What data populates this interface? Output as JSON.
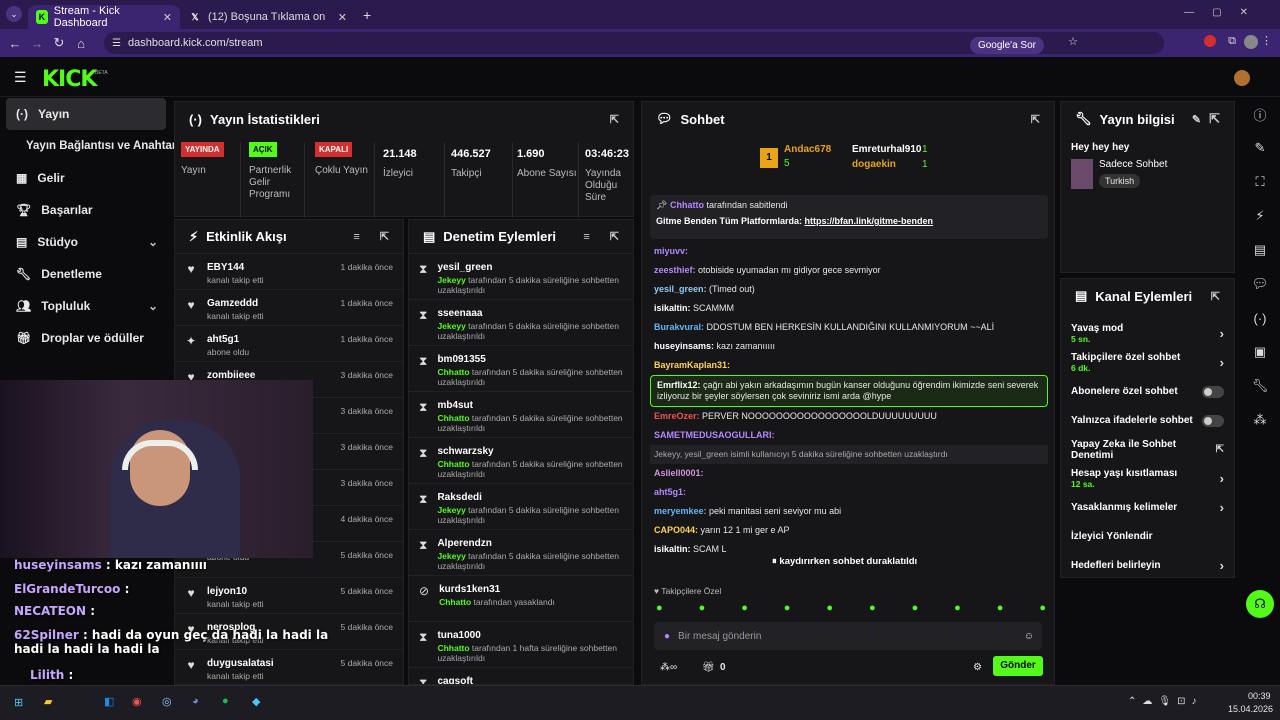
{
  "browser": {
    "tabs": [
      {
        "title": "Stream - Kick Dashboard",
        "active": true
      },
      {
        "title": "(12) Boşuna Tıklama on X: \"Bir ...",
        "active": false
      }
    ],
    "url": "dashboard.kick.com/stream",
    "google_btn": "Google'a Sor"
  },
  "brand": {
    "logo": "KICK",
    "beta": "BETA",
    "accent": "#53fc18"
  },
  "sidebar": {
    "items": [
      {
        "label": "Yayın",
        "icon": "broadcast-icon"
      },
      {
        "label": "Yayın Bağlantısı ve Anahtarı",
        "icon": ""
      },
      {
        "label": "Gelir",
        "icon": "revenue-icon"
      },
      {
        "label": "Başarılar",
        "icon": "trophy-icon"
      },
      {
        "label": "Stüdyo",
        "icon": "studio-icon"
      },
      {
        "label": "Denetleme",
        "icon": "wrench-icon"
      },
      {
        "label": "Topluluk",
        "icon": "community-icon"
      },
      {
        "label": "Droplar ve ödüller",
        "icon": "gift-icon"
      }
    ]
  },
  "stats": {
    "title": "Yayın İstatistikleri",
    "items": [
      {
        "badge": "YAYINDA",
        "label": "Yayın"
      },
      {
        "badge": "AÇIK",
        "label": "Partnerlik Gelir Programı"
      },
      {
        "badge": "KAPALI",
        "label": "Çoklu Yayın"
      },
      {
        "value": "21.148",
        "label": "İzleyici"
      },
      {
        "value": "446.527",
        "label": "Takipçi"
      },
      {
        "value": "1.690",
        "label": "Abone Sayısı"
      },
      {
        "value": "03:46:23",
        "label": "Yayında Olduğu Süre"
      }
    ]
  },
  "activity": {
    "title": "Etkinlik Akışı",
    "rows": [
      {
        "name": "EBY144",
        "sub": "kanalı takip etti",
        "time": "1 dakika önce",
        "icon": "heart"
      },
      {
        "name": "Gamzeddd",
        "sub": "kanalı takip etti",
        "time": "1 dakika önce",
        "icon": "heart"
      },
      {
        "name": "aht5g1",
        "sub": "abone oldu",
        "time": "1 dakika önce",
        "icon": "star"
      },
      {
        "name": "zombiieee",
        "sub": "",
        "time": "3 dakika önce",
        "icon": "heart"
      },
      {
        "name": "",
        "sub": "",
        "time": "3 dakika önce",
        "icon": ""
      },
      {
        "name": "",
        "sub": "",
        "time": "3 dakika önce",
        "icon": ""
      },
      {
        "name": "",
        "sub": "",
        "time": "3 dakika önce",
        "icon": ""
      },
      {
        "name": "",
        "sub": "",
        "time": "4 dakika önce",
        "icon": ""
      },
      {
        "name": "",
        "sub": "abone oldu",
        "time": "5 dakika önce",
        "icon": ""
      },
      {
        "name": "lejyon10",
        "sub": "kanalı takip etti",
        "time": "5 dakika önce",
        "icon": "heart"
      },
      {
        "name": "nerosplog",
        "sub": "kanalı takip etti",
        "time": "5 dakika önce",
        "icon": "heart"
      },
      {
        "name": "duygusalatasi",
        "sub": "kanalı takip etti",
        "time": "5 dakika önce",
        "icon": "heart"
      }
    ]
  },
  "moderation": {
    "title": "Denetim Eylemleri",
    "rows": [
      {
        "name": "yesil_green",
        "by": "Jekeyy",
        "sub": " tarafından 5 dakika süreliğine sohbetten uzaklaştırıldı",
        "time": "1 dakika önce",
        "icon": "⧗"
      },
      {
        "name": "sseenaaa",
        "by": "Jekeyy",
        "sub": " tarafından 5 dakika süreliğine sohbetten uzaklaştırıldı",
        "time": "1 dakika önce",
        "icon": "⧗"
      },
      {
        "name": "bm091355",
        "by": "Chhatto",
        "sub": " tarafından 5 dakika süreliğine sohbetten uzaklaştırıldı",
        "time": "1 dakika önce",
        "icon": "⧗"
      },
      {
        "name": "mb4sut",
        "by": "Chhatto",
        "sub": " tarafından 5 dakika süreliğine sohbetten uzaklaştırıldı",
        "time": "1 dakika önce",
        "icon": "⧗"
      },
      {
        "name": "schwarzsky",
        "by": "Chhatto",
        "sub": " tarafından 5 dakika süreliğine sohbetten uzaklaştırıldı",
        "time": "4 dakika önce",
        "icon": "⧗"
      },
      {
        "name": "Raksdedi",
        "by": "Jekeyy",
        "sub": " tarafından 5 dakika süreliğine sohbetten uzaklaştırıldı",
        "time": "4 dakika önce",
        "icon": "⧗"
      },
      {
        "name": "Alperendzn",
        "by": "Jekeyy",
        "sub": " tarafından 5 dakika süreliğine sohbetten uzaklaştırıldı",
        "time": "7 dakika önce",
        "icon": "⧗"
      },
      {
        "name": "kurds1ken31",
        "by": "Chhatto",
        "sub": " tarafından yasaklandı",
        "time": "13 dakika önce",
        "icon": "⊘"
      },
      {
        "name": "tuna1000",
        "by": "Chhatto",
        "sub": " tarafından 1 hafta süreliğine sohbetten uzaklaştırıldı",
        "time": "51 dakika önce",
        "icon": "⧗"
      },
      {
        "name": "cagsoft",
        "by": "",
        "sub": "",
        "time": "53 dakika önce",
        "icon": "⧗"
      }
    ]
  },
  "chat": {
    "title": "Sohbet",
    "leaders": [
      {
        "rank": "1",
        "name": "Andac678",
        "count": "5"
      },
      {
        "rank": "",
        "name": "Emreturhal910",
        "count": "1"
      },
      {
        "rank": "",
        "name": "dogaekin",
        "count": "1"
      }
    ],
    "pinned": {
      "by": "Chhatto",
      "by_suffix": " tarafından sabitlendi",
      "text": "Gitme Benden Tüm Platformlarda: ",
      "link": "https://bfan.link/gitme-benden"
    },
    "messages": [
      {
        "user": "miyuvv:",
        "text": "",
        "color": "#b388ff"
      },
      {
        "user": "zeesthief:",
        "text": " otobiside uyumadan mı gidiyor gece sevmiyor",
        "color": "#b388ff"
      },
      {
        "user": "yesil_green:",
        "text": " (Timed out)",
        "color": "#90caf9"
      },
      {
        "user": "isikaltin:",
        "text": " SCAMMM",
        "color": "#ffffff"
      },
      {
        "user": "Burakvural:",
        "text": " DDOSTUM BEN HERKESİN KULLANDIĞINI KULLANMIYORUM ~~ALİ",
        "color": "#64b5f6"
      },
      {
        "user": "huseyinsams:",
        "text": " kazı zamanııııı",
        "color": "#ffffff"
      },
      {
        "user": "BayramKaplan31:",
        "text": "",
        "color": "#ffd54f"
      },
      {
        "user": "Emrflix12:",
        "text": " çağrı abi yakın arkadaşımın bugün kanser olduğunu öğrendim ikimizde seni severek izliyoruz bir şeyler söylersen çok seviniriz ismi arda @hype",
        "color": "#ffffff"
      },
      {
        "user": "EmreOzer:",
        "text": " PERVER NOOOOOOOOOOOOOOOOOLDUUUUUUUUU",
        "color": "#ef5350"
      },
      {
        "user": "SAMETMEDUSAOGULLARI:",
        "text": "",
        "color": "#b388ff"
      },
      {
        "user": "",
        "text": "Jekeyy, yesil_green isimli kullanıcıyı 5 dakika süreliğine sohbetten uzaklaştırdı",
        "color": "#aaaaaa"
      },
      {
        "user": "Asliell0001:",
        "text": "",
        "color": "#ce93d8"
      },
      {
        "user": "aht5g1:",
        "text": "",
        "color": "#b388ff"
      },
      {
        "user": "meryemkee:",
        "text": " peki manitasi seni seviyor mu abi",
        "color": "#64b5f6"
      },
      {
        "user": "CAPO044:",
        "text": " yarın 12 1 mi ger e AP",
        "color": "#ffd54f"
      },
      {
        "user": "isikaltin:",
        "text": " SCAM L",
        "color": "#ffffff"
      }
    ],
    "paused": "kaydırırken sohbet duraklatıldı",
    "followers_only": "Takipçilere Özel",
    "input_placeholder": "Bir mesaj gönderin",
    "send": "Gönder",
    "gift_count": "0"
  },
  "stream_info": {
    "title": "Yayın bilgisi",
    "stream_title": "Hey hey hey",
    "category": "Sadece Sohbet",
    "tag": "Turkish"
  },
  "channel_actions": {
    "title": "Kanal Eylemleri",
    "items": [
      {
        "label": "Yavaş mod",
        "sub": "5 sn.",
        "type": "arrow"
      },
      {
        "label": "Takipçilere özel sohbet",
        "sub": "6 dk.",
        "type": "arrow"
      },
      {
        "label": "Abonelere özel sohbet",
        "sub": "",
        "type": "toggle"
      },
      {
        "label": "Yalnızca ifadelerle sohbet",
        "sub": "",
        "type": "toggle"
      },
      {
        "label": "Yapay Zeka ile Sohbet Denetimi",
        "sub": "",
        "type": "external"
      },
      {
        "label": "Hesap yaşı kısıtlaması",
        "sub": "12 sa.",
        "type": "arrow"
      },
      {
        "label": "Yasaklanmış kelimeler",
        "sub": "",
        "type": "arrow"
      },
      {
        "label": "İzleyici Yönlendir",
        "sub": "",
        "type": "none"
      },
      {
        "label": "Hedefleri belirleyin",
        "sub": "",
        "type": "arrow"
      }
    ]
  },
  "overlay_chat": [
    {
      "user": "huseyinsams",
      "text": " : kazı zamanıııı",
      "color": "#c7a6ff"
    },
    {
      "user": "ElGrandeTurcoo",
      "text": " :",
      "color": "#c7a6ff"
    },
    {
      "user": "NECATEON",
      "text": " :",
      "color": "#c7a6ff"
    },
    {
      "user": "62Spilner",
      "text": " : hadi da oyun geç da hadi la hadi la hadi la hadi la hadi la",
      "color": "#c7a6ff"
    },
    {
      "user": "Lilith",
      "text": " :",
      "color": "#c7a6ff"
    }
  ],
  "taskbar": {
    "time": "00:39",
    "date": "15.04.2026"
  }
}
